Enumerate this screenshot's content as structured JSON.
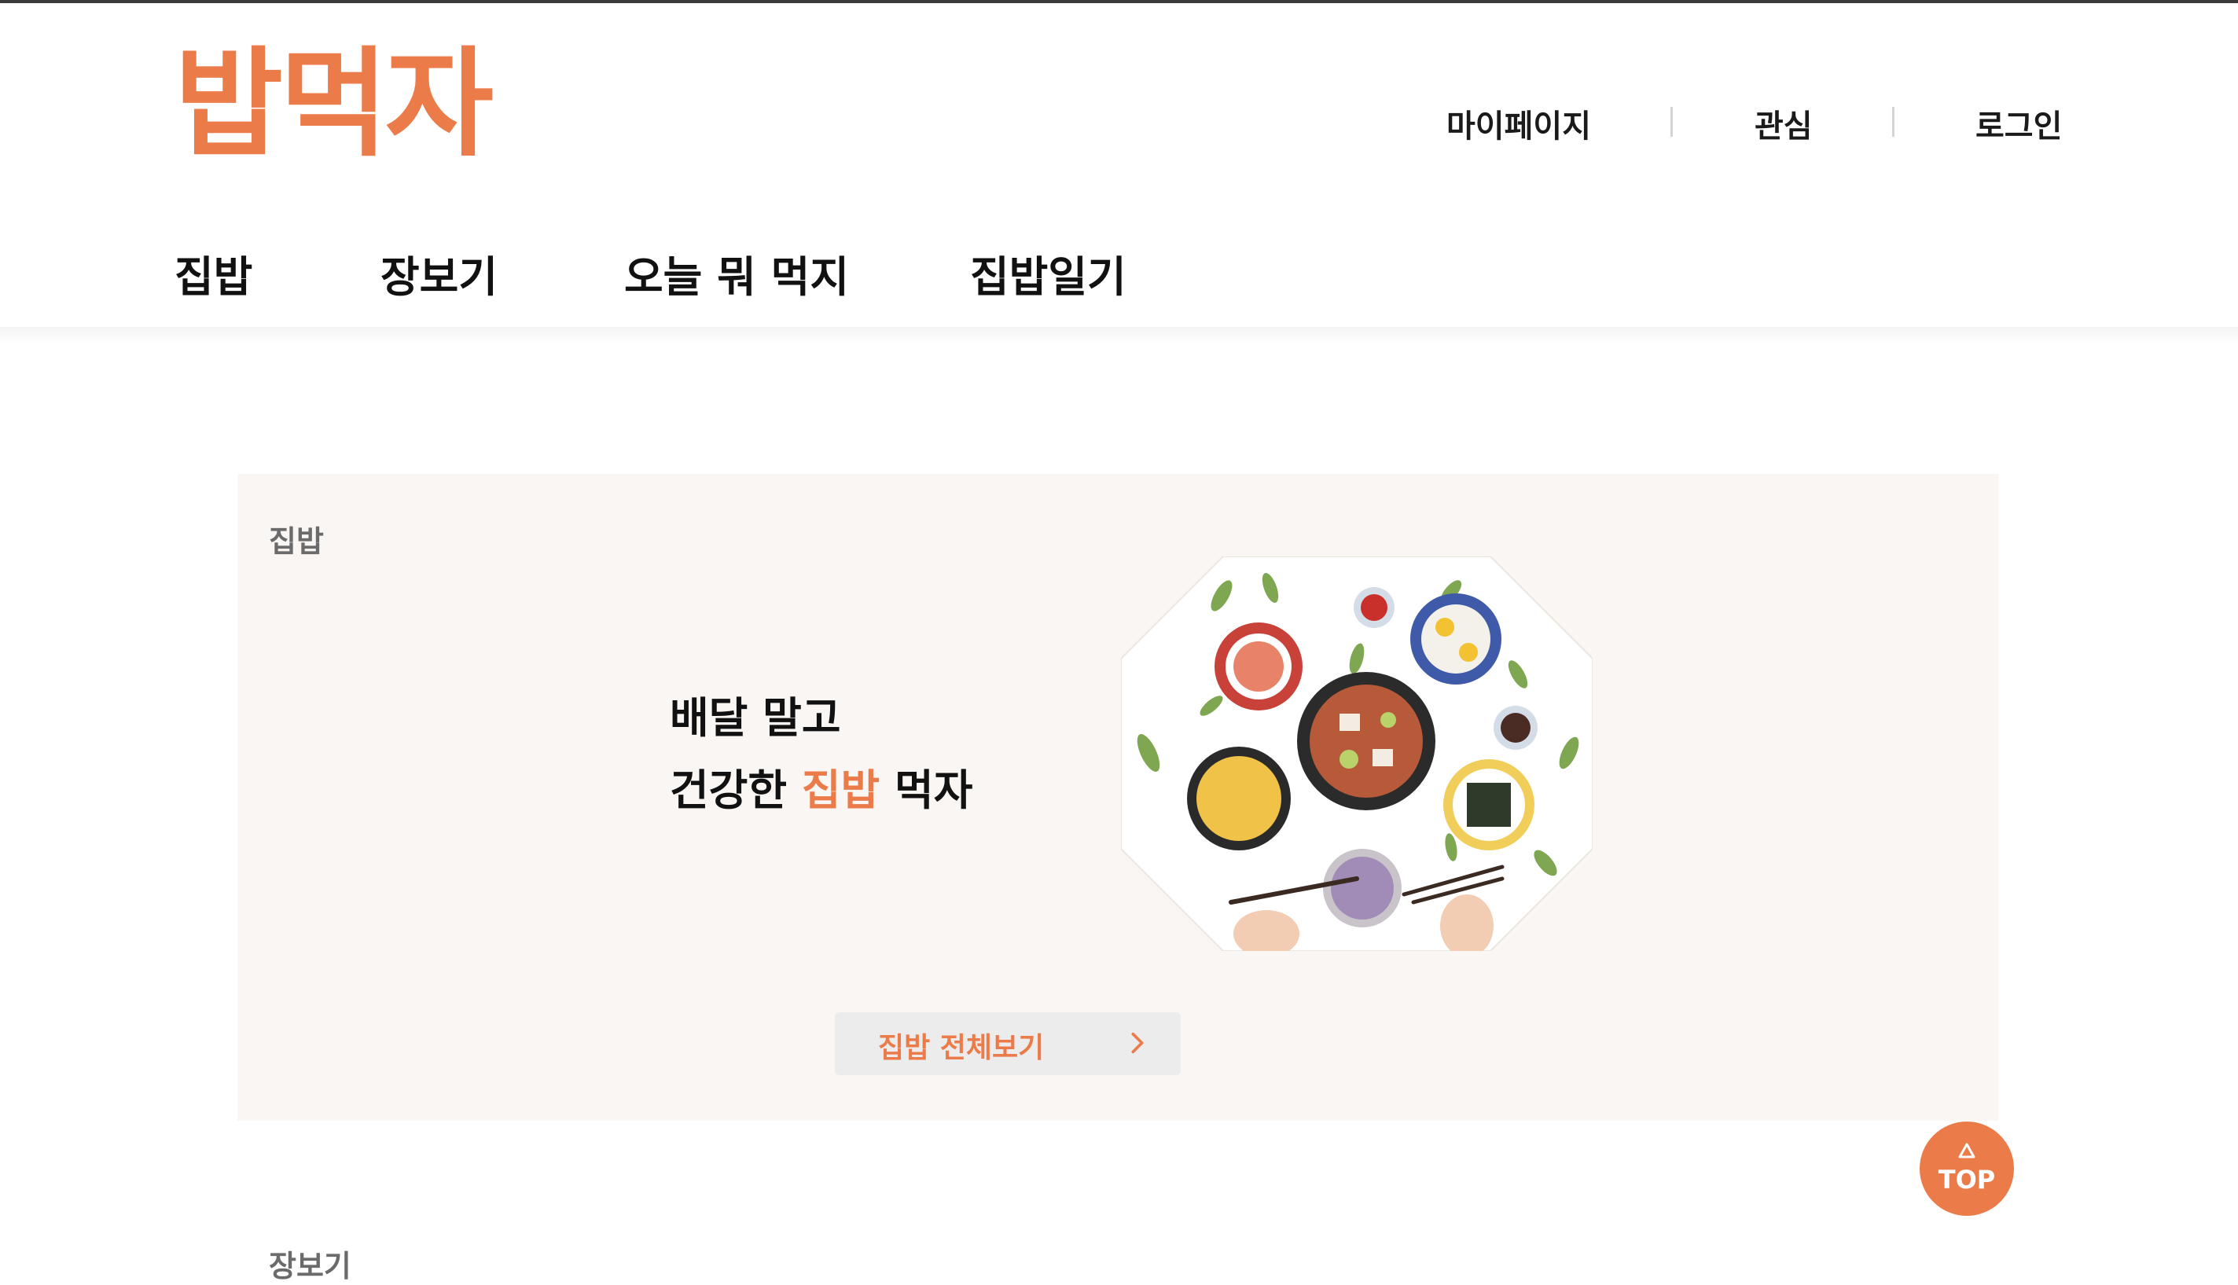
{
  "brand": {
    "logo": "밥먹자",
    "accent_color": "#ec7b4a"
  },
  "util_nav": {
    "items": [
      "마이페이지",
      "관심",
      "로그인"
    ]
  },
  "main_nav": {
    "items": [
      "집밥",
      "장보기",
      "오늘 뭐 먹지",
      "집밥일기"
    ]
  },
  "section_homemeal": {
    "label": "집밥",
    "headline_line1": "배달 말고",
    "headline_line2_prefix": "건강한",
    "headline_line2_accent": "집밥",
    "headline_line2_suffix": "먹자",
    "more_button_label": "집밥 전체보기",
    "more_icon": "chevron-right-icon",
    "illustration": "korean-home-meal-table-illustration"
  },
  "top_button": {
    "label": "TOP",
    "icon": "triangle-up-icon"
  },
  "section_shopping": {
    "label": "장보기"
  }
}
